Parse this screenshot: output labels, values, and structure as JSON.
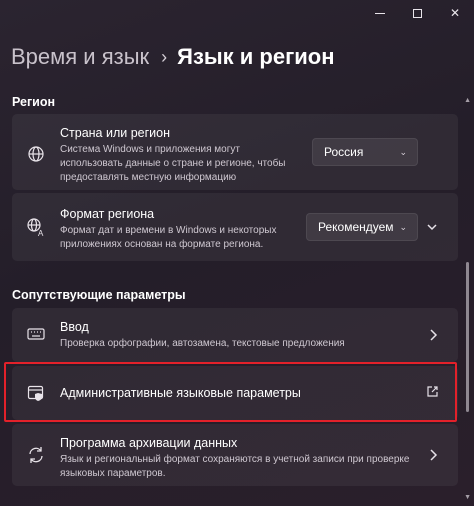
{
  "window": {
    "minimize_label": "",
    "maximize_label": "",
    "close_label": "✕"
  },
  "breadcrumb": {
    "parent": "Время и язык",
    "separator": "›",
    "current": "Язык и регион"
  },
  "sections": {
    "region": "Регион",
    "related": "Сопутствующие параметры"
  },
  "region_items": {
    "country": {
      "icon": "globe-icon",
      "title": "Страна или регион",
      "description": "Система Windows и приложения могут\nиспользовать данные о стране и регионе, чтобы\nпредоставлять местную информацию",
      "value": "Россия"
    },
    "format": {
      "icon": "regional-format-icon",
      "title": "Формат региона",
      "description": "Формат дат и времени в Windows и некоторых\nприложениях основан на формате региона.",
      "value": "Рекомендуем"
    }
  },
  "related_items": {
    "typing": {
      "icon": "keyboard-icon",
      "title": "Ввод",
      "description": "Проверка орфографии, автозамена, текстовые предложения"
    },
    "admin_lang": {
      "icon": "admin-language-icon",
      "title": "Административные языковые параметры"
    },
    "backup": {
      "icon": "sync-backup-icon",
      "title": "Программа архивации данных",
      "description": "Язык и региональный формат сохраняются в учетной записи при проверке\nязыковых параметров."
    }
  },
  "colors": {
    "background": "#2b2430",
    "card": "#37303b",
    "highlight": "#e3212a",
    "text_primary": "#ffffff",
    "text_secondary": "#cfc8d1"
  }
}
